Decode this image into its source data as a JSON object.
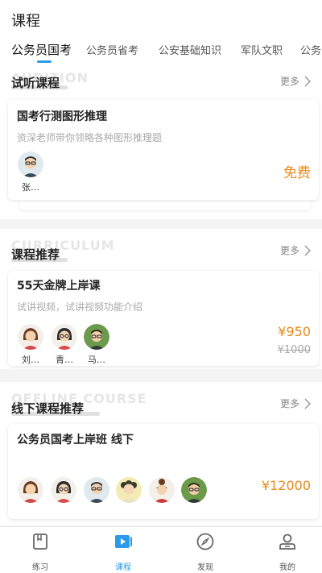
{
  "header": {
    "title": "课程"
  },
  "tabs": [
    {
      "label": "公务员国考",
      "active": true
    },
    {
      "label": "公务员省考"
    },
    {
      "label": "公安基础知识"
    },
    {
      "label": "军队文职"
    },
    {
      "label": "公务"
    }
  ],
  "sections": {
    "audition": {
      "bg_text": "AUDITION",
      "title": "试听课程",
      "more": "更多",
      "card": {
        "title": "国考行测图形推理",
        "desc": "资深老师带你领略各种图形推理题",
        "price": "免费",
        "teachers": [
          {
            "name": "张…",
            "avatar": "man-glasses-avatar"
          }
        ]
      }
    },
    "curriculum": {
      "bg_text": "CURRICULUM",
      "title": "课程推荐",
      "more": "更多",
      "card": {
        "title": "55天金牌上岸课",
        "desc": "试讲视频，试讲视频功能介绍",
        "price": "¥950",
        "price_old": "¥1000",
        "teachers": [
          {
            "name": "刘…",
            "avatar": "woman-avatar"
          },
          {
            "name": "青…",
            "avatar": "woman-glasses-avatar"
          },
          {
            "name": "马…",
            "avatar": "man-green-avatar"
          }
        ]
      }
    },
    "offline": {
      "bg_text": "OFFLINE COURSE",
      "title": "线下课程推荐",
      "more": "更多",
      "card": {
        "title": "公务员国考上岸班 线下",
        "price": "¥12000",
        "teachers": [
          {
            "avatar": "woman-avatar"
          },
          {
            "avatar": "woman-glasses-avatar"
          },
          {
            "avatar": "man-glasses-avatar"
          },
          {
            "avatar": "woman-curly-avatar"
          },
          {
            "avatar": "woman-bun-avatar"
          },
          {
            "avatar": "man-green-avatar"
          }
        ]
      }
    }
  },
  "bottom_nav": [
    {
      "label": "练习",
      "icon": "book-icon"
    },
    {
      "label": "课程",
      "icon": "play-icon",
      "active": true
    },
    {
      "label": "发现",
      "icon": "compass-icon"
    },
    {
      "label": "我的",
      "icon": "user-icon"
    }
  ],
  "colors": {
    "accent": "#2a9be8",
    "price": "#e88a1a"
  }
}
